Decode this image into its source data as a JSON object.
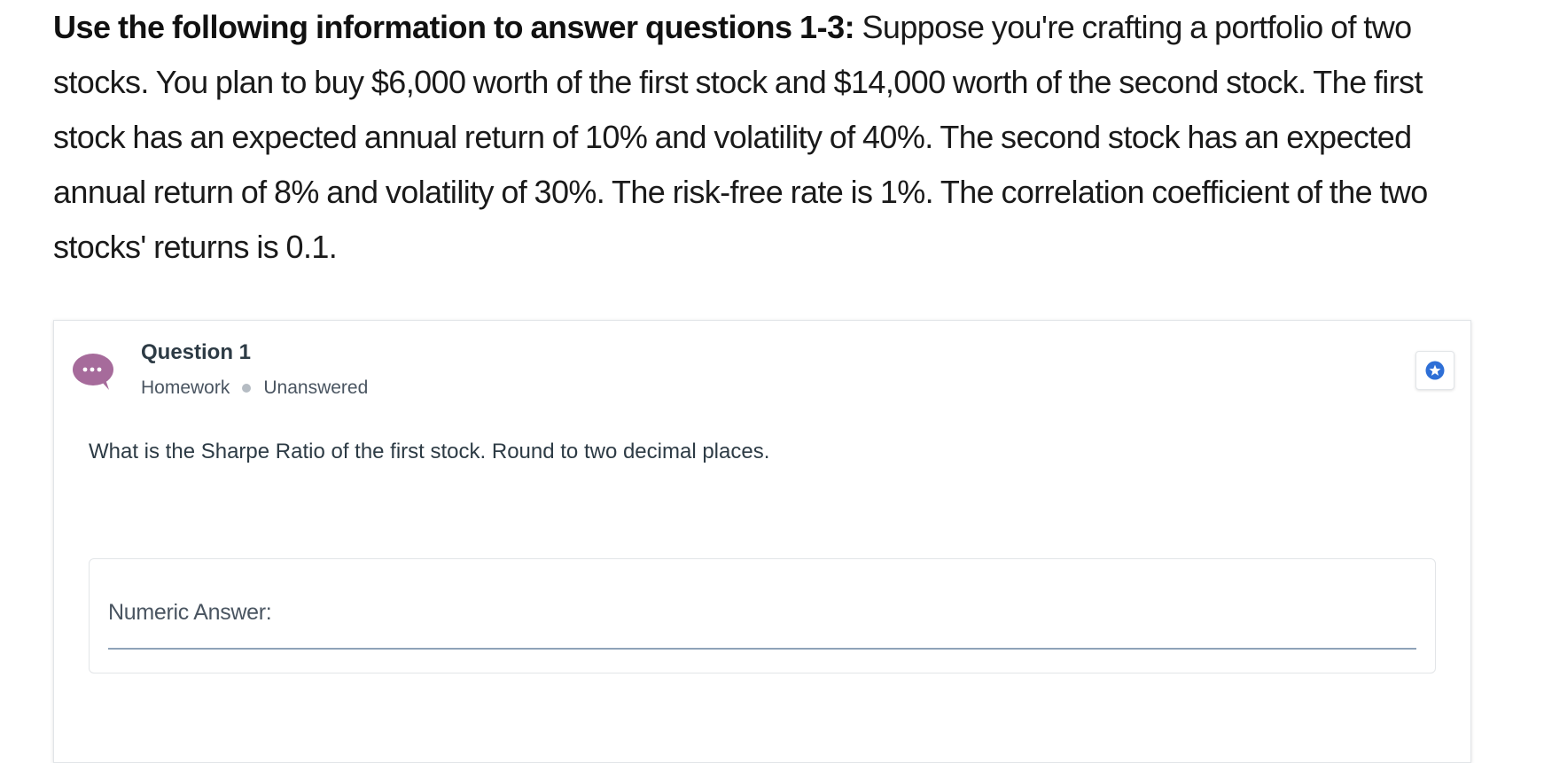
{
  "intro": {
    "lead_bold": "Use the following information to answer questions 1-3:",
    "body": " Suppose you're crafting a portfolio of two stocks. You plan to buy $6,000 worth of the first stock and $14,000 worth of the second stock. The first stock has an expected annual return of 10% and volatility of 40%. The second stock has an expected annual return of 8% and volatility of 30%. The risk-free rate is 1%. The correlation coefficient of the two stocks' returns is 0.1."
  },
  "question": {
    "title": "Question 1",
    "type": "Homework",
    "status": "Unanswered",
    "prompt": "What is the Sharpe Ratio of the first stock. Round to two decimal places.",
    "icon": "speech-bubble-ellipsis-icon",
    "bookmark_icon": "star-icon"
  },
  "answer": {
    "label": "Numeric Answer:",
    "value": ""
  },
  "colors": {
    "question_icon": "#a66b9b",
    "bookmark_accent": "#2e6fd6",
    "input_underline": "#8fa3b8",
    "text_dark": "#2d3b45"
  }
}
